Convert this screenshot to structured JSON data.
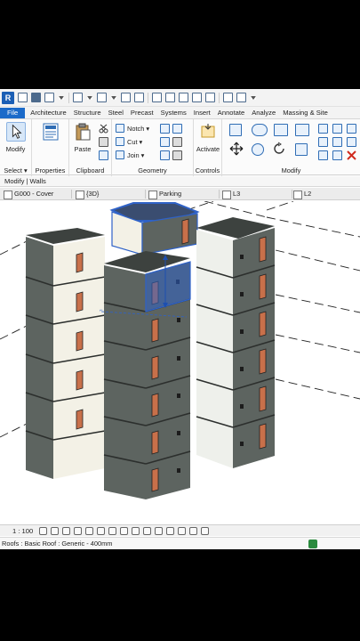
{
  "app": {
    "logo": "R",
    "active_tab": "Modify"
  },
  "tabs": [
    "File",
    "Architecture",
    "Structure",
    "Steel",
    "Precast",
    "Systems",
    "Insert",
    "Annotate",
    "Analyze",
    "Massing & Site"
  ],
  "ribbon": {
    "modify_label": "Modify",
    "select_label": "Select ▾",
    "properties_label": "Properties",
    "clipboard_label": "Clipboard",
    "paste_label": "Paste",
    "notch_label": "Notch ▾",
    "cut_label": "Cut ▾",
    "join_label": "Join ▾",
    "geometry_label": "Geometry",
    "activate_label": "Activate",
    "controls_label": "Controls",
    "modify_panel_label": "Modify"
  },
  "options_bar": {
    "context": "Modify | Walls"
  },
  "view_tabs": [
    "G000 - Cover",
    "{3D}",
    "Parking",
    "L3",
    "L2"
  ],
  "view_control": {
    "scale": "1 : 100"
  },
  "status_bar": {
    "text": "Roofs : Basic Roof : Generic - 400mm"
  },
  "icons": [
    "modify-cursor-icon",
    "properties-icon",
    "paste-icon",
    "scissors-icon",
    "copy-icon",
    "join-icon",
    "activate-icon",
    "move-icon",
    "rotate-icon",
    "mirror-icon",
    "delete-icon",
    "filter-icon"
  ],
  "colors": {
    "file_tab": "#1b6ac9",
    "wall": "#5d6460",
    "door": "#c8704a",
    "selection": "#2f62c7"
  }
}
